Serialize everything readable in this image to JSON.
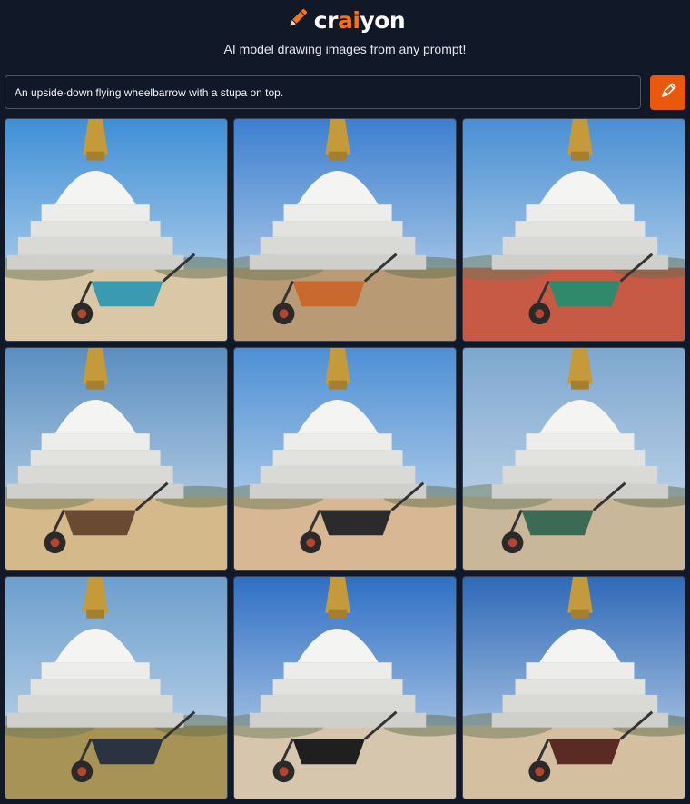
{
  "header": {
    "brand": {
      "part1": "cr",
      "accent": "ai",
      "part2": "yon"
    },
    "tagline": "AI model drawing images from any prompt!"
  },
  "prompt": {
    "value": "An upside-down flying wheelbarrow with a stupa on top."
  },
  "colors": {
    "background": "#111827",
    "accent": "#f97316",
    "button": "#ea580c"
  },
  "icons": {
    "logo": "pencil-icon",
    "draw_button": "pencil-icon"
  },
  "results": [
    {
      "index": 1,
      "sky": "#3f8fd6",
      "ground": "#d9c7a6",
      "barrow": "#3a9ab0"
    },
    {
      "index": 2,
      "sky": "#3c7fcf",
      "ground": "#b89b74",
      "barrow": "#c9692e"
    },
    {
      "index": 3,
      "sky": "#4a8fd3",
      "ground": "#c65a45",
      "barrow": "#2f8a6b"
    },
    {
      "index": 4,
      "sky": "#5a8ec0",
      "ground": "#d4b98a",
      "barrow": "#6a4a30"
    },
    {
      "index": 5,
      "sky": "#4d8fd4",
      "ground": "#d8b894",
      "barrow": "#2b2b2b"
    },
    {
      "index": 6,
      "sky": "#7ea7cf",
      "ground": "#c9b79a",
      "barrow": "#3d6a55"
    },
    {
      "index": 7,
      "sky": "#6d9fcd",
      "ground": "#a89357",
      "barrow": "#2c3340"
    },
    {
      "index": 8,
      "sky": "#2f6fc4",
      "ground": "#d6c6ad",
      "barrow": "#1f1f1f"
    },
    {
      "index": 9,
      "sky": "#2f69b7",
      "ground": "#d4bfa1",
      "barrow": "#5a2b22"
    }
  ]
}
